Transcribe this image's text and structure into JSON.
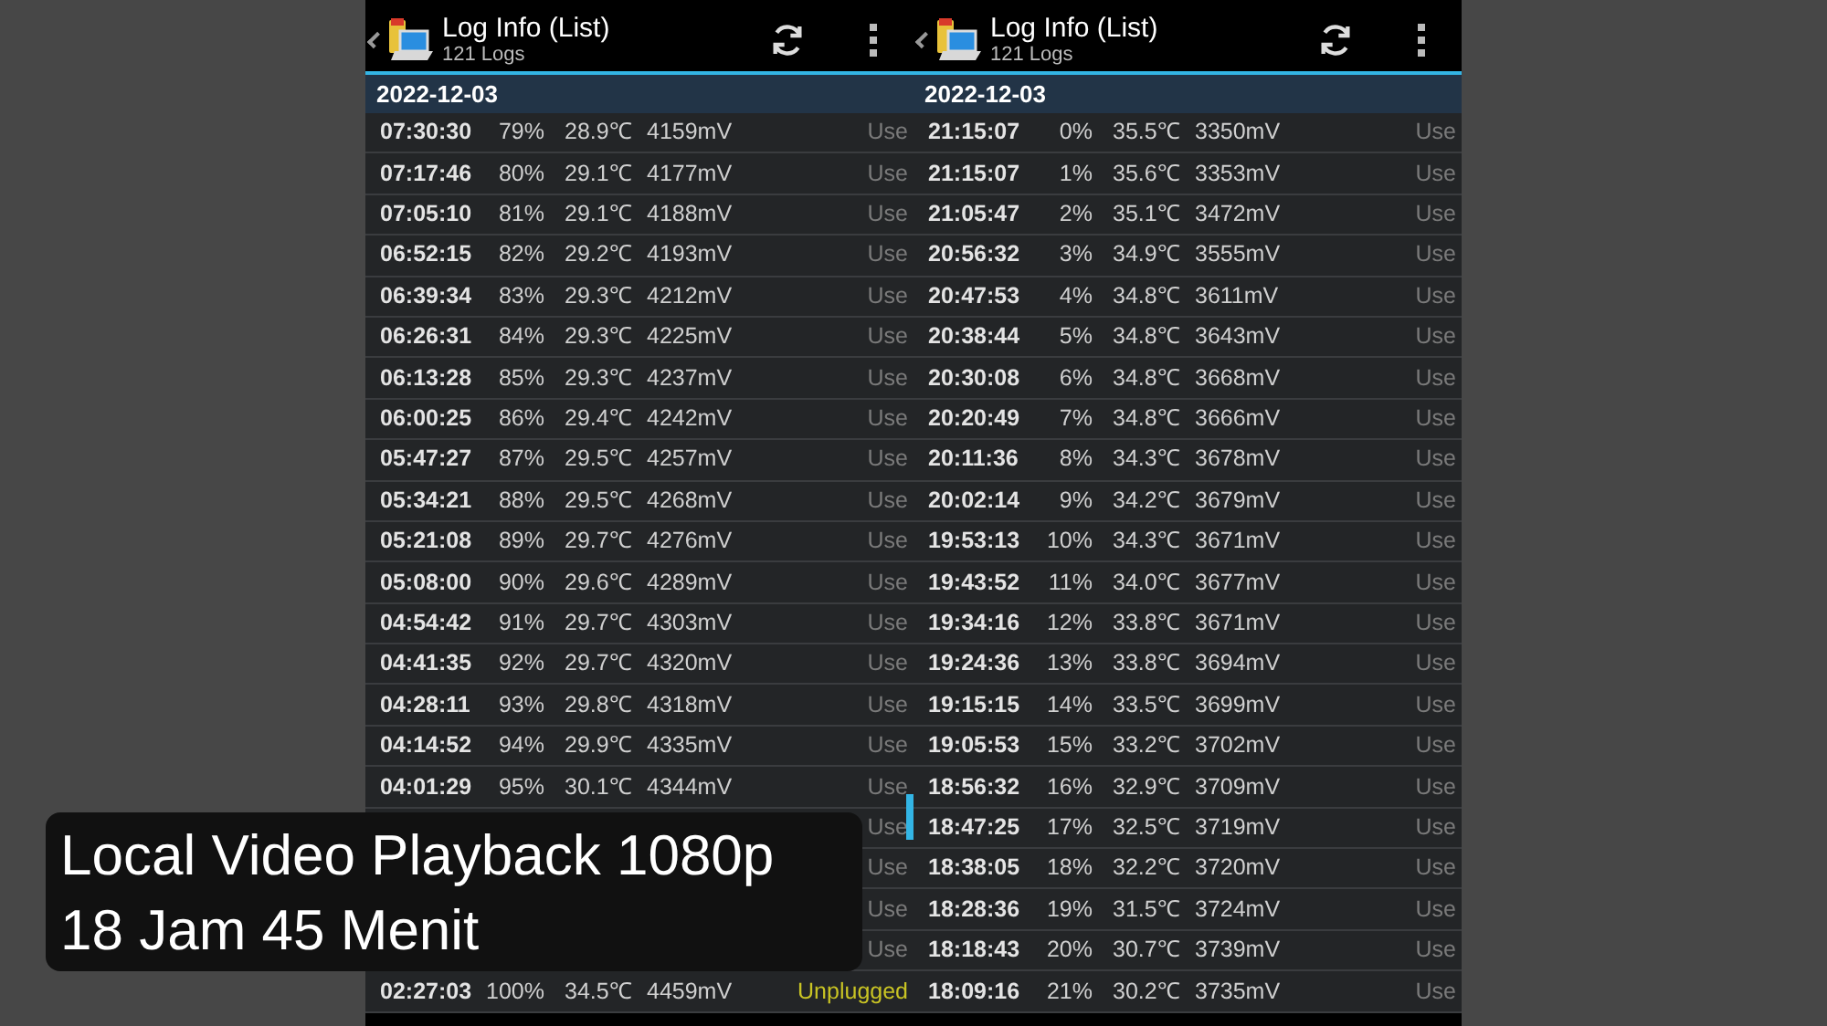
{
  "panels": [
    {
      "header": {
        "title": "Log Info (List)",
        "subtitle": "121 Logs"
      },
      "date": "2022-12-03",
      "rows": [
        {
          "time": "07:30:30",
          "percent": "79%",
          "temp": "28.9℃",
          "voltage": "4159mV",
          "status": "Use",
          "color": "#7a7a7a"
        },
        {
          "time": "07:17:46",
          "percent": "80%",
          "temp": "29.1℃",
          "voltage": "4177mV",
          "status": "Use",
          "color": "#7a7a7a"
        },
        {
          "time": "07:05:10",
          "percent": "81%",
          "temp": "29.1℃",
          "voltage": "4188mV",
          "status": "Use",
          "color": "#7a7a7a"
        },
        {
          "time": "06:52:15",
          "percent": "82%",
          "temp": "29.2℃",
          "voltage": "4193mV",
          "status": "Use",
          "color": "#7a7a7a"
        },
        {
          "time": "06:39:34",
          "percent": "83%",
          "temp": "29.3℃",
          "voltage": "4212mV",
          "status": "Use",
          "color": "#7a7a7a"
        },
        {
          "time": "06:26:31",
          "percent": "84%",
          "temp": "29.3℃",
          "voltage": "4225mV",
          "status": "Use",
          "color": "#7a7a7a"
        },
        {
          "time": "06:13:28",
          "percent": "85%",
          "temp": "29.3℃",
          "voltage": "4237mV",
          "status": "Use",
          "color": "#7a7a7a"
        },
        {
          "time": "06:00:25",
          "percent": "86%",
          "temp": "29.4℃",
          "voltage": "4242mV",
          "status": "Use",
          "color": "#7a7a7a"
        },
        {
          "time": "05:47:27",
          "percent": "87%",
          "temp": "29.5℃",
          "voltage": "4257mV",
          "status": "Use",
          "color": "#7a7a7a"
        },
        {
          "time": "05:34:21",
          "percent": "88%",
          "temp": "29.5℃",
          "voltage": "4268mV",
          "status": "Use",
          "color": "#7a7a7a"
        },
        {
          "time": "05:21:08",
          "percent": "89%",
          "temp": "29.7℃",
          "voltage": "4276mV",
          "status": "Use",
          "color": "#7a7a7a"
        },
        {
          "time": "05:08:00",
          "percent": "90%",
          "temp": "29.6℃",
          "voltage": "4289mV",
          "status": "Use",
          "color": "#7a7a7a"
        },
        {
          "time": "04:54:42",
          "percent": "91%",
          "temp": "29.7℃",
          "voltage": "4303mV",
          "status": "Use",
          "color": "#7a7a7a"
        },
        {
          "time": "04:41:35",
          "percent": "92%",
          "temp": "29.7℃",
          "voltage": "4320mV",
          "status": "Use",
          "color": "#7a7a7a"
        },
        {
          "time": "04:28:11",
          "percent": "93%",
          "temp": "29.8℃",
          "voltage": "4318mV",
          "status": "Use",
          "color": "#7a7a7a"
        },
        {
          "time": "04:14:52",
          "percent": "94%",
          "temp": "29.9℃",
          "voltage": "4335mV",
          "status": "Use",
          "color": "#7a7a7a"
        },
        {
          "time": "04:01:29",
          "percent": "95%",
          "temp": "30.1℃",
          "voltage": "4344mV",
          "status": "Use",
          "color": "#7a7a7a"
        },
        {
          "status": "Use",
          "color": "#7a7a7a"
        },
        {
          "status": "Use",
          "color": "#7a7a7a"
        },
        {
          "status": "Use",
          "color": "#7a7a7a"
        },
        {
          "status": "Use",
          "color": "#7a7a7a"
        },
        {
          "time": "02:27:03",
          "percent": "100%",
          "temp": "34.5℃",
          "voltage": "4459mV",
          "status": "Unplugged",
          "color": "#c9c424"
        }
      ]
    },
    {
      "header": {
        "title": "Log Info (List)",
        "subtitle": "121 Logs"
      },
      "date": "2022-12-03",
      "rows": [
        {
          "time": "21:15:07",
          "percent": "0%",
          "temp": "35.5℃",
          "voltage": "3350mV",
          "status": "Use",
          "color": "#7a7a7a"
        },
        {
          "time": "21:15:07",
          "percent": "1%",
          "temp": "35.6℃",
          "voltage": "3353mV",
          "status": "Use",
          "color": "#7a7a7a"
        },
        {
          "time": "21:05:47",
          "percent": "2%",
          "temp": "35.1℃",
          "voltage": "3472mV",
          "status": "Use",
          "color": "#7a7a7a"
        },
        {
          "time": "20:56:32",
          "percent": "3%",
          "temp": "34.9℃",
          "voltage": "3555mV",
          "status": "Use",
          "color": "#7a7a7a"
        },
        {
          "time": "20:47:53",
          "percent": "4%",
          "temp": "34.8℃",
          "voltage": "3611mV",
          "status": "Use",
          "color": "#7a7a7a"
        },
        {
          "time": "20:38:44",
          "percent": "5%",
          "temp": "34.8℃",
          "voltage": "3643mV",
          "status": "Use",
          "color": "#7a7a7a"
        },
        {
          "time": "20:30:08",
          "percent": "6%",
          "temp": "34.8℃",
          "voltage": "3668mV",
          "status": "Use",
          "color": "#7a7a7a"
        },
        {
          "time": "20:20:49",
          "percent": "7%",
          "temp": "34.8℃",
          "voltage": "3666mV",
          "status": "Use",
          "color": "#7a7a7a"
        },
        {
          "time": "20:11:36",
          "percent": "8%",
          "temp": "34.3℃",
          "voltage": "3678mV",
          "status": "Use",
          "color": "#7a7a7a"
        },
        {
          "time": "20:02:14",
          "percent": "9%",
          "temp": "34.2℃",
          "voltage": "3679mV",
          "status": "Use",
          "color": "#7a7a7a"
        },
        {
          "time": "19:53:13",
          "percent": "10%",
          "temp": "34.3℃",
          "voltage": "3671mV",
          "status": "Use",
          "color": "#7a7a7a"
        },
        {
          "time": "19:43:52",
          "percent": "11%",
          "temp": "34.0℃",
          "voltage": "3677mV",
          "status": "Use",
          "color": "#7a7a7a"
        },
        {
          "time": "19:34:16",
          "percent": "12%",
          "temp": "33.8℃",
          "voltage": "3671mV",
          "status": "Use",
          "color": "#7a7a7a"
        },
        {
          "time": "19:24:36",
          "percent": "13%",
          "temp": "33.8℃",
          "voltage": "3694mV",
          "status": "Use",
          "color": "#7a7a7a"
        },
        {
          "time": "19:15:15",
          "percent": "14%",
          "temp": "33.5℃",
          "voltage": "3699mV",
          "status": "Use",
          "color": "#7a7a7a"
        },
        {
          "time": "19:05:53",
          "percent": "15%",
          "temp": "33.2℃",
          "voltage": "3702mV",
          "status": "Use",
          "color": "#7a7a7a"
        },
        {
          "time": "18:56:32",
          "percent": "16%",
          "temp": "32.9℃",
          "voltage": "3709mV",
          "status": "Use",
          "color": "#7a7a7a"
        },
        {
          "time": "18:47:25",
          "percent": "17%",
          "temp": "32.5℃",
          "voltage": "3719mV",
          "status": "Use",
          "color": "#7a7a7a"
        },
        {
          "time": "18:38:05",
          "percent": "18%",
          "temp": "32.2℃",
          "voltage": "3720mV",
          "status": "Use",
          "color": "#7a7a7a"
        },
        {
          "time": "18:28:36",
          "percent": "19%",
          "temp": "31.5℃",
          "voltage": "3724mV",
          "status": "Use",
          "color": "#7a7a7a"
        },
        {
          "time": "18:18:43",
          "percent": "20%",
          "temp": "30.7℃",
          "voltage": "3739mV",
          "status": "Use",
          "color": "#7a7a7a"
        },
        {
          "time": "18:09:16",
          "percent": "21%",
          "temp": "30.2℃",
          "voltage": "3735mV",
          "status": "Use",
          "color": "#7a7a7a"
        }
      ]
    }
  ],
  "caption": {
    "lines": [
      "Local Video Playback 1080p",
      "18 Jam 45 Menit"
    ]
  }
}
